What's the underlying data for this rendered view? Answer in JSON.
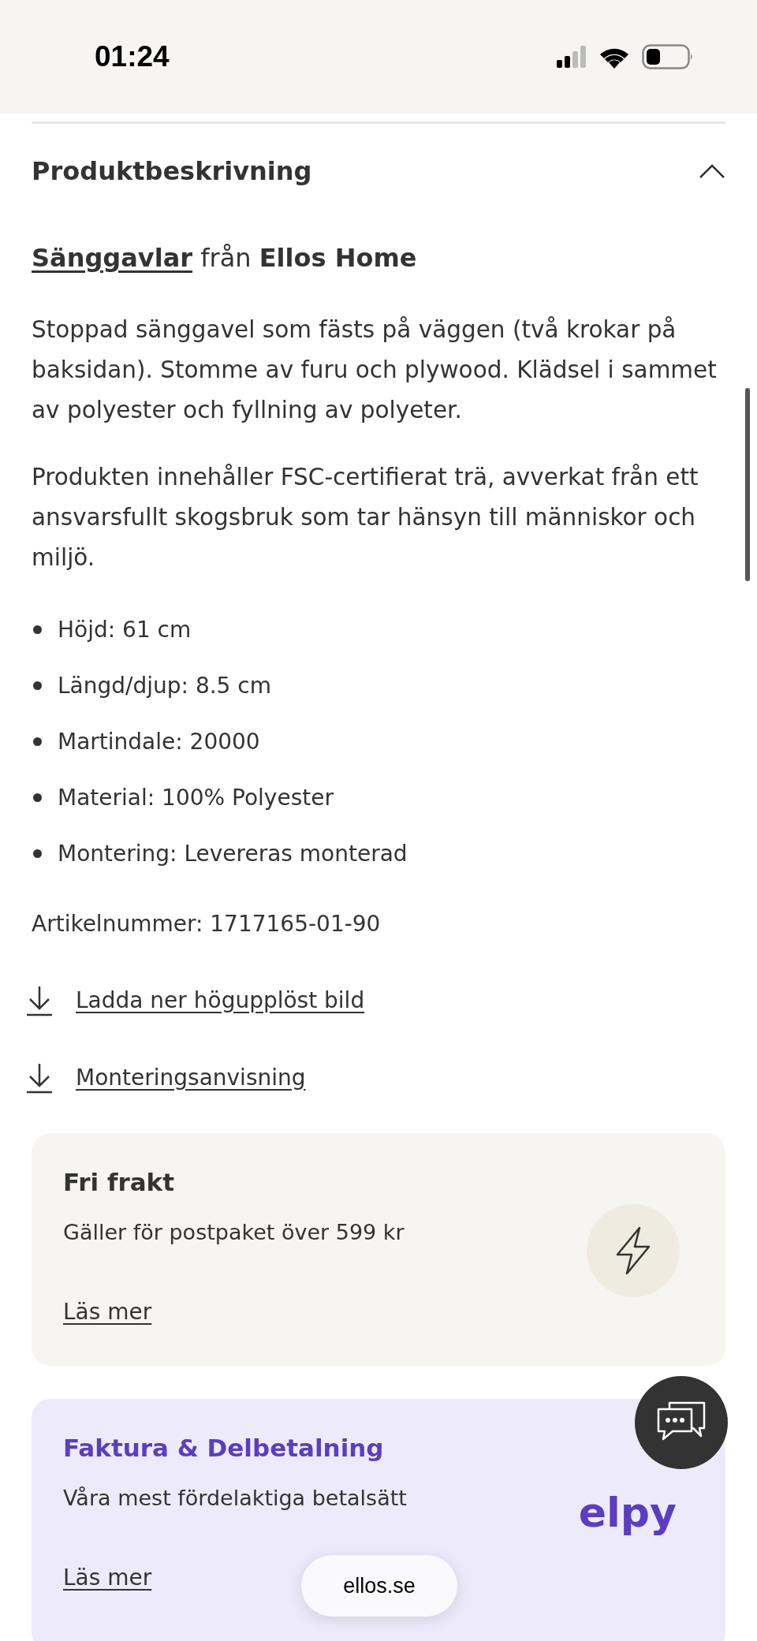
{
  "status_bar": {
    "time": "01:24"
  },
  "section": {
    "title": "Produktbeskrivning",
    "expanded": true
  },
  "origin": {
    "link": "Sänggavlar",
    "text": " från **Ellos Home**"
  },
  "paragraphs": [
    "Stoppad sänggavel som fästs på väggen (två krokar på baksidan). Stomme av furu och plywood. Klädsel i sammet av polyester och fyllning av polyeter.",
    "Produkten innehåller FSC-certifierat trä, avverkat från ett ansvarsfullt skogsbruk som tar hänsyn till människor och miljö."
  ],
  "specs": [
    "Höjd: 61 cm",
    "Längd/djup: 8.5 cm",
    "Martindale: 20000",
    "Material: 100% Polyester",
    "Montering: Levereras monterad"
  ],
  "article_number": "Artikelnummer: 1717165-01-90",
  "downloads": [
    "Ladda ner högupplöst bild",
    "Monteringsanvisning"
  ],
  "cards": [
    {
      "kind": "shipping",
      "title": "Fri frakt",
      "text": "Gäller för postpaket över 599 kr",
      "link": "Läs mer"
    },
    {
      "kind": "payment",
      "title": "Faktura & Delbetalning",
      "text": "Våra mest fördelaktiga betalsätt",
      "link": "Läs mer",
      "logo": "elpy"
    }
  ],
  "url_pill": "ellos.se"
}
